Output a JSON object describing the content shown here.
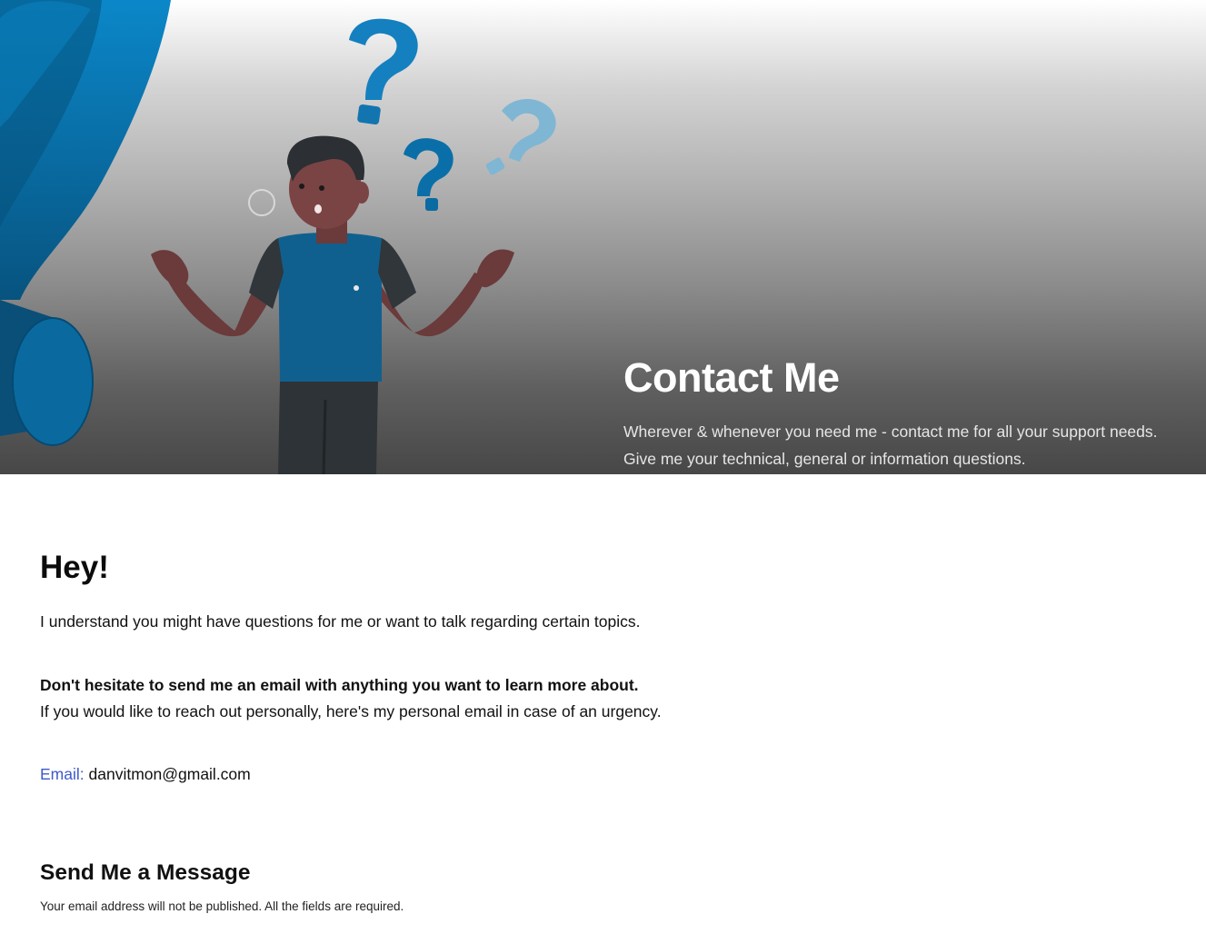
{
  "hero": {
    "title": "Contact Me",
    "subtitle_line1": "Wherever & whenever you need me - contact me for all your support needs.",
    "subtitle_line2": "Give me your technical, general or information questions.",
    "illustration": "confused-person-with-question-marks",
    "colors": {
      "accent_blue": "#0a7cc0",
      "light_blue": "#7fb6d4",
      "shirt": "#10608f",
      "skin": "#6b3a3a",
      "sleeve": "#30363a"
    }
  },
  "intro": {
    "heading": "Hey!",
    "paragraph": "I understand you might have questions for me or want to talk regarding certain topics.",
    "bold_line": "Don't hesitate to send me an email with anything you want to learn more about.",
    "paragraph2": "If you would like to reach out personally, here's my personal email in case of an urgency."
  },
  "contact": {
    "email_label": "Email:",
    "email_value": "danvitmon@gmail.com",
    "label_color": "#3d5bc9"
  },
  "form": {
    "title": "Send Me a Message",
    "note": "Your email address will not be published. All the fields are required."
  }
}
